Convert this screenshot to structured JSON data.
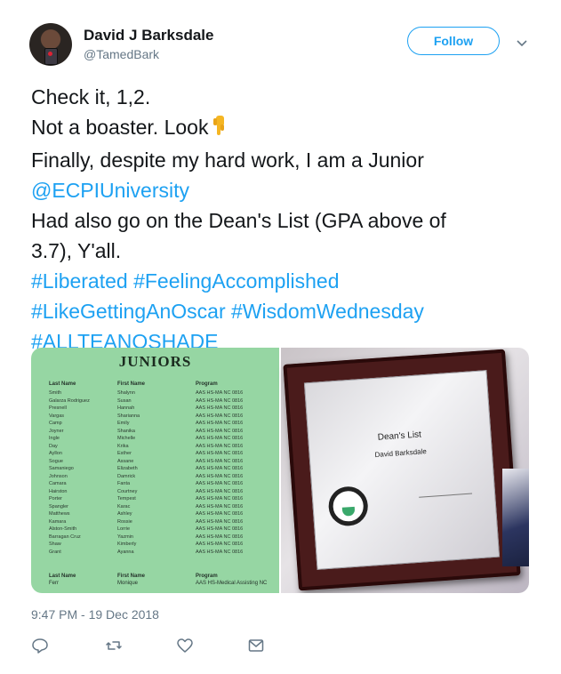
{
  "author": {
    "name": "David J Barksdale",
    "handle": "@TamedBark"
  },
  "follow_label": "Follow",
  "tweet": {
    "lines": [
      {
        "text": "Check it, 1,2.",
        "kind": "text"
      },
      {
        "text": "Not a boaster. Look",
        "kind": "text"
      },
      {
        "text": "Finally, despite my hard work, I am a Junior",
        "kind": "text"
      },
      {
        "text": "@ECPIUniversity",
        "kind": "mention"
      },
      {
        "text": "Had also go on the Dean's List (GPA above of",
        "kind": "text"
      },
      {
        "text": "3.7), Y'all.",
        "kind": "text"
      },
      {
        "text": "#Liberated #FeelingAccomplished",
        "kind": "hashtag"
      },
      {
        "text": "#LikeGettingAnOscar #WisdomWednesday",
        "kind": "hashtag"
      },
      {
        "text": "#ALLTEANOSHADE",
        "kind": "hashtag"
      }
    ],
    "emoji": "pointing-down-emoji"
  },
  "media": {
    "left_photo": {
      "title": "JUNIORS",
      "headers": {
        "last": "Last Name",
        "first": "First Name",
        "program": "Program"
      },
      "last_names": [
        "Smith",
        "Galarza Rodriguez",
        "Presnell",
        "Vargas",
        "Camp",
        "Joyner",
        "Ingle",
        "Day",
        "Ayllon",
        "Sogue",
        "Samaniego",
        "Johnson",
        "Camara",
        "Hairston",
        "Porter",
        "Spangler",
        "Matthews",
        "Kamara",
        "Alston-Smith",
        "Barragan Cruz",
        "Shaw",
        "Grant"
      ],
      "first_names": [
        "Shalynn",
        "Susan",
        "Hannah",
        "Sharianna",
        "Emily",
        "Shanika",
        "Michelle",
        "Krika",
        "Esther",
        "Assane",
        "Elizabeth",
        "Damrick",
        "Fanta",
        "Courtney",
        "Tempest",
        "Karac",
        "Ashley",
        "Rossie",
        "Lorrie",
        "Yazmin",
        "Kimberly",
        "Ayanna"
      ],
      "program": "AAS HS-MA NC 0816",
      "footer": {
        "last": "Ferr",
        "first": "Monique",
        "program": "AAS HS-Medical Assisting  NC"
      }
    },
    "right_photo": {
      "cert_title": "Dean's List",
      "cert_name": "David Barksdale"
    }
  },
  "timestamp": "9:47 PM - 19 Dec 2018",
  "colors": {
    "link": "#1da1f2",
    "text": "#14171a",
    "muted": "#657786"
  }
}
